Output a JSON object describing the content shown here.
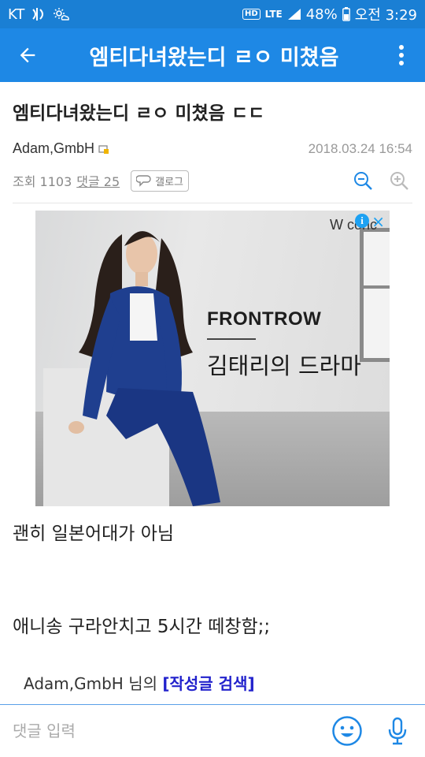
{
  "status_bar": {
    "carrier": "KT",
    "network": "LTE",
    "battery": "48%",
    "time": "오전 3:29",
    "icons": [
      "nfc-icon",
      "weather-icon",
      "hd-voice-icon",
      "lte-icon",
      "signal-icon",
      "battery-icon"
    ]
  },
  "app_bar": {
    "title": "엠티다녀왔는디 ㄹㅇ 미쳤음",
    "back_icon": "arrow-left-icon",
    "menu_icon": "more-vert-icon"
  },
  "post": {
    "title": "엠티다녀왔는디 ㄹㅇ 미쳤음 ㄷㄷ",
    "author": "Adam,GmbH",
    "date": "2018.03.24 16:54",
    "views_label": "조회 1103",
    "comments_label": "댓글 25",
    "gallery_label": "갤로그"
  },
  "ad": {
    "brand": "W conc",
    "headline": "FRONTROW",
    "subtitle": "김태리의 드라마",
    "info_icon": "i",
    "close_icon": "×",
    "colors": {
      "suit": "#1f3f8f",
      "accent": "#1da1f2"
    }
  },
  "body": {
    "line1": "괜히 일본어대가 아님",
    "line2": "애니송 구라안치고 5시간 떼창함;;",
    "author_search_prefix": "Adam,GmbH 님의 ",
    "author_search_link": "[작성글 검색]"
  },
  "comment_bar": {
    "placeholder": "댓글 입력"
  },
  "colors": {
    "primary": "#1e88e5",
    "status_bar": "#1a7fd4",
    "link": "#2222cc"
  }
}
